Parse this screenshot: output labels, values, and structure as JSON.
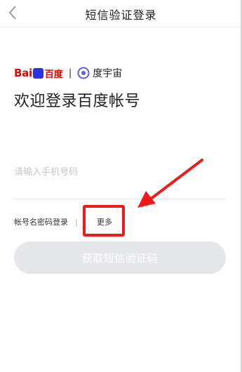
{
  "nav": {
    "title": "短信验证登录",
    "back_icon": "chevron-left-icon"
  },
  "brand": {
    "baidu_bai": "Bai",
    "baidu_text": "百度",
    "divider": "|",
    "dyz_text": "度宇宙",
    "colors": {
      "baidu_red": "#e10602",
      "baidu_blue": "#2932e1",
      "dyz_accent": "#5a63d8"
    }
  },
  "welcome_text": "欢迎登录百度帐号",
  "phone": {
    "placeholder": "请输入手机号码",
    "value": ""
  },
  "links": {
    "password_login": "帐号名密码登录",
    "separator": "|",
    "more": "更多"
  },
  "submit_label": "获取短信验证码",
  "annotation": {
    "color": "#ee1b1b"
  }
}
